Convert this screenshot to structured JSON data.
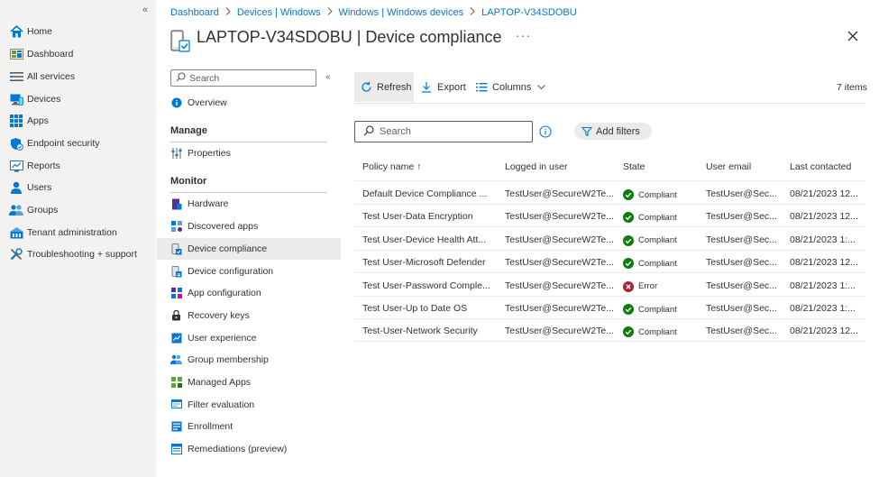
{
  "nav": {
    "collapse": "«",
    "items": [
      {
        "label": "Home",
        "icon": "home-icon"
      },
      {
        "label": "Dashboard",
        "icon": "dashboard-icon"
      },
      {
        "label": "All services",
        "icon": "all-services-icon"
      },
      {
        "label": "Devices",
        "icon": "devices-icon"
      },
      {
        "label": "Apps",
        "icon": "apps-icon"
      },
      {
        "label": "Endpoint security",
        "icon": "endpoint-security-icon"
      },
      {
        "label": "Reports",
        "icon": "reports-icon"
      },
      {
        "label": "Users",
        "icon": "users-icon"
      },
      {
        "label": "Groups",
        "icon": "groups-icon"
      },
      {
        "label": "Tenant administration",
        "icon": "tenant-admin-icon"
      },
      {
        "label": "Troubleshooting + support",
        "icon": "troubleshooting-icon"
      }
    ]
  },
  "breadcrumb": [
    "Dashboard",
    "Devices | Windows",
    "Windows | Windows devices",
    "LAPTOP-V34SDOBU"
  ],
  "breadcrumb_sep": ">",
  "header": {
    "title": "LAPTOP-V34SDOBU | Device compliance",
    "more": "···",
    "close": "close"
  },
  "menu": {
    "search_placeholder": "Search",
    "collapse": "«",
    "overview": {
      "label": "Overview",
      "icon": "info-icon"
    },
    "manage_header": "Manage",
    "manage_items": [
      {
        "label": "Properties",
        "icon": "properties-icon"
      }
    ],
    "monitor_header": "Monitor",
    "monitor_items": [
      {
        "label": "Hardware",
        "icon": "hardware-icon"
      },
      {
        "label": "Discovered apps",
        "icon": "discovered-apps-icon"
      },
      {
        "label": "Device compliance",
        "icon": "device-compliance-icon",
        "selected": true
      },
      {
        "label": "Device configuration",
        "icon": "device-configuration-icon"
      },
      {
        "label": "App configuration",
        "icon": "app-configuration-icon"
      },
      {
        "label": "Recovery keys",
        "icon": "recovery-keys-icon"
      },
      {
        "label": "User experience",
        "icon": "user-experience-icon"
      },
      {
        "label": "Group membership",
        "icon": "group-membership-icon"
      },
      {
        "label": "Managed Apps",
        "icon": "managed-apps-icon"
      },
      {
        "label": "Filter evaluation",
        "icon": "filter-evaluation-icon"
      },
      {
        "label": "Enrollment",
        "icon": "enrollment-icon"
      },
      {
        "label": "Remediations (preview)",
        "icon": "remediations-icon"
      }
    ]
  },
  "toolbar": {
    "refresh": "Refresh",
    "export": "Export",
    "columns": "Columns",
    "items_count": "7 items"
  },
  "grid": {
    "search_placeholder": "Search",
    "add_filters": "Add filters",
    "columns": [
      "Policy name ↑",
      "Logged in user",
      "State",
      "User email",
      "Last contacted"
    ],
    "rows": [
      {
        "policy": "Default Device Compliance ...",
        "user": "TestUser@SecureW2Te...",
        "state": "Compliant",
        "status": "ok",
        "email": "TestUser@Sec...",
        "contacted": "08/21/2023 12..."
      },
      {
        "policy": "Test User-Data Encryption",
        "user": "TestUser@SecureW2Te...",
        "state": "Compliant",
        "status": "ok",
        "email": "TestUser@Sec...",
        "contacted": "08/21/2023 12..."
      },
      {
        "policy": "Test User-Device Health Att...",
        "user": "TestUser@SecureW2Te...",
        "state": "Compliant",
        "status": "ok",
        "email": "TestUser@Sec...",
        "contacted": "08/21/2023 1:..."
      },
      {
        "policy": "Test User-Microsoft Defender",
        "user": "TestUser@SecureW2Te...",
        "state": "Compliant",
        "status": "ok",
        "email": "TestUser@Sec...",
        "contacted": "08/21/2023 12..."
      },
      {
        "policy": "Test User-Password Comple...",
        "user": "TestUser@SecureW2Te...",
        "state": "Error",
        "status": "error",
        "email": "TestUser@Sec...",
        "contacted": "08/21/2023 1:..."
      },
      {
        "policy": "Test User-Up to Date OS",
        "user": "TestUser@SecureW2Te...",
        "state": "Compliant",
        "status": "ok",
        "email": "TestUser@Sec...",
        "contacted": "08/21/2023 1:..."
      },
      {
        "policy": "Test-User-Network Security",
        "user": "TestUser@SecureW2Te...",
        "state": "Compliant",
        "status": "ok",
        "email": "TestUser@Sec...",
        "contacted": "08/21/2023 12..."
      }
    ]
  },
  "colors": {
    "accent": "#0078d4",
    "success": "#107c10",
    "error": "#a4262c"
  }
}
